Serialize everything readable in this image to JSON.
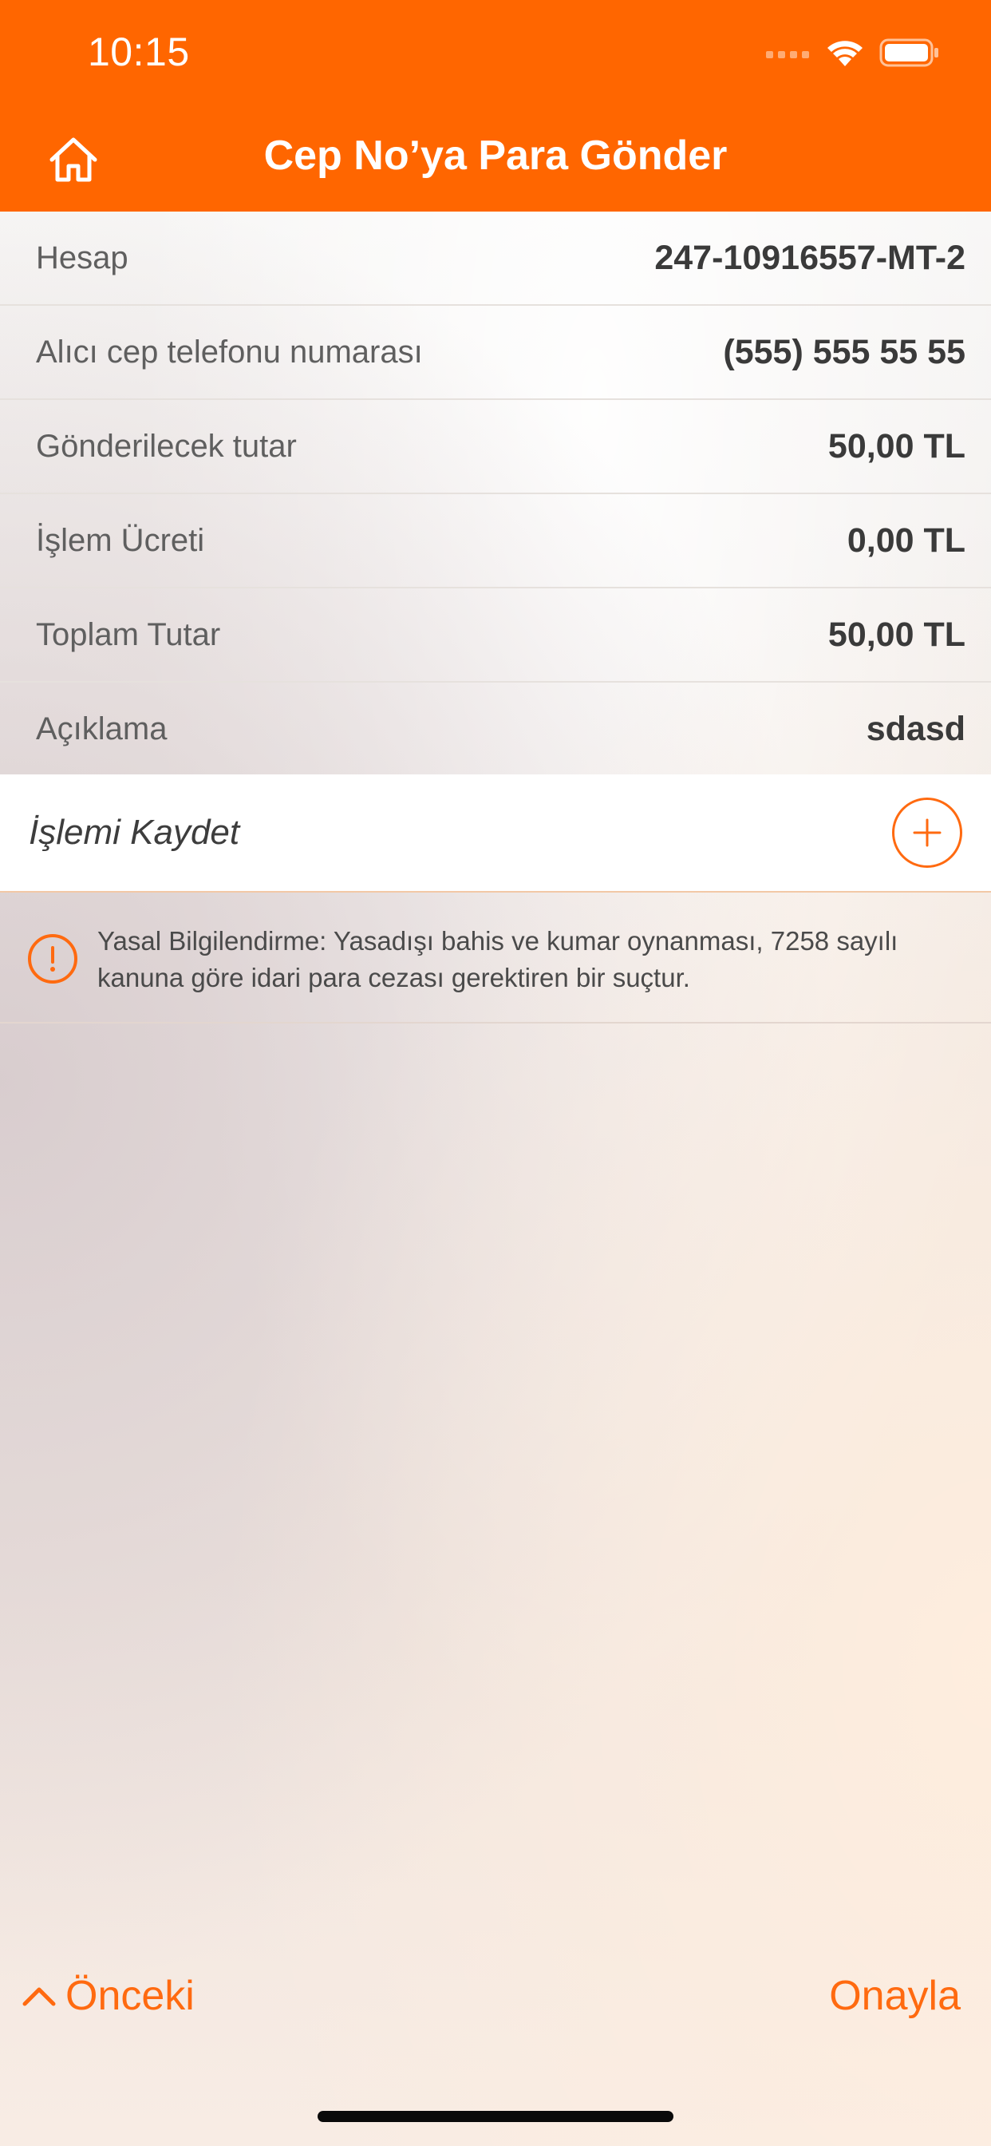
{
  "status_bar": {
    "time": "10:15"
  },
  "header": {
    "title": "Cep No’ya Para Gönder"
  },
  "details": [
    {
      "label": "Hesap",
      "value": "247-10916557-MT-2"
    },
    {
      "label": "Alıcı cep telefonu numarası",
      "value": "(555) 555 55 55"
    },
    {
      "label": "Gönderilecek tutar",
      "value": "50,00 TL"
    },
    {
      "label": "İşlem Ücreti",
      "value": "0,00 TL"
    },
    {
      "label": "Toplam Tutar",
      "value": "50,00 TL"
    },
    {
      "label": "Açıklama",
      "value": "sdasd"
    }
  ],
  "save": {
    "label": "İşlemi Kaydet"
  },
  "legal": {
    "text": "Yasal Bilgilendirme: Yasadışı bahis ve kumar oynanması, 7258 sayılı kanuna göre idari para cezası gerektiren bir suçtur."
  },
  "footer": {
    "prev_label": "Önceki",
    "confirm_label": "Onayla"
  },
  "colors": {
    "accent": "#ff6600",
    "header_text": "#ffffff",
    "link": "#ff6a10"
  },
  "icons": {
    "home": "home-icon",
    "add": "plus-icon",
    "warning": "exclamation-icon",
    "prev": "chevron-up-icon"
  }
}
